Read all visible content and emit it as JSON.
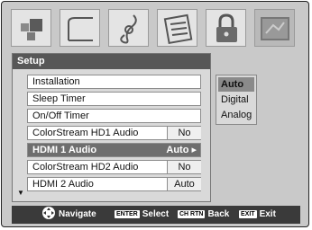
{
  "menu": {
    "title": "Setup",
    "items": [
      {
        "label": "Installation"
      },
      {
        "label": "Sleep Timer"
      },
      {
        "label": "On/Off Timer"
      },
      {
        "label": "ColorStream HD1 Audio",
        "value": "No"
      },
      {
        "label": "HDMI 1 Audio",
        "value": "Auto ▸",
        "selected": true
      },
      {
        "label": "ColorStream HD2 Audio",
        "value": "No"
      },
      {
        "label": "HDMI 2 Audio",
        "value": "Auto"
      }
    ],
    "scroll_icon": "scroll-down-arrow"
  },
  "icons": [
    "picture-icon",
    "sound-icon",
    "preferences-icon",
    "lock-icon",
    "setup-icon"
  ],
  "options": {
    "items": [
      "Auto",
      "Digital",
      "Analog"
    ],
    "selected": "Auto"
  },
  "footer": {
    "navigate": "Navigate",
    "enter_key": "ENTER",
    "select": "Select",
    "chrtn_key": "CH RTN",
    "back": "Back",
    "exit_key": "EXIT",
    "exit": "Exit"
  }
}
